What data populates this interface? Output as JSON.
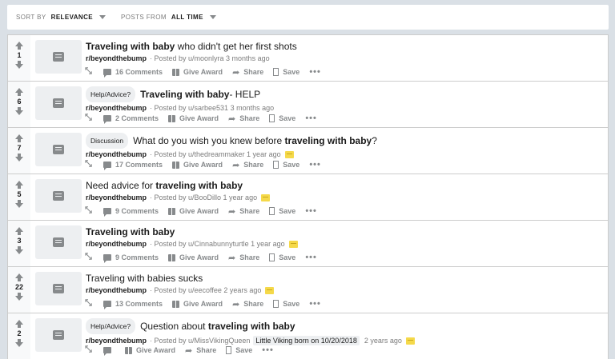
{
  "sort": {
    "label": "Sort by",
    "value": "RELEVANCE",
    "posts_label": "Posts from",
    "posts_value": "ALL TIME"
  },
  "posts": [
    {
      "score": "1",
      "flair": "",
      "title_parts": [
        {
          "text": "Traveling with baby",
          "bold": true
        },
        {
          "text": " who didn't get her first shots",
          "bold": false
        }
      ],
      "sub": "r/beyondthebump",
      "posted": "· Posted by u/moonlyra 3 months ago",
      "user_flair": "",
      "award": false,
      "comments": "16 Comments"
    },
    {
      "score": "6",
      "flair": "Help/Advice?",
      "title_parts": [
        {
          "text": "Traveling with baby",
          "bold": true
        },
        {
          "text": "- HELP",
          "bold": false
        }
      ],
      "sub": "r/beyondthebump",
      "posted": "· Posted by u/sarbee531 3 months ago",
      "user_flair": "",
      "award": false,
      "comments": "2 Comments"
    },
    {
      "score": "7",
      "flair": "Discussion",
      "title_parts": [
        {
          "text": "What do you wish you knew before ",
          "bold": false
        },
        {
          "text": "traveling with baby",
          "bold": true
        },
        {
          "text": "?",
          "bold": false
        }
      ],
      "sub": "r/beyondthebump",
      "posted": "· Posted by u/thedreammaker 1 year ago",
      "user_flair": "",
      "award": true,
      "comments": "17 Comments"
    },
    {
      "score": "5",
      "flair": "",
      "title_parts": [
        {
          "text": "Need advice for ",
          "bold": false
        },
        {
          "text": "traveling with baby",
          "bold": true
        }
      ],
      "sub": "r/beyondthebump",
      "posted": "· Posted by u/BooDillo 1 year ago",
      "user_flair": "",
      "award": true,
      "comments": "9 Comments"
    },
    {
      "score": "3",
      "flair": "",
      "title_parts": [
        {
          "text": "Traveling with baby",
          "bold": true
        }
      ],
      "sub": "r/beyondthebump",
      "posted": "· Posted by u/Cinnabunnyturtle 1 year ago",
      "user_flair": "",
      "award": true,
      "comments": "9 Comments"
    },
    {
      "score": "22",
      "flair": "",
      "title_parts": [
        {
          "text": "Traveling with babies sucks",
          "bold": false
        }
      ],
      "sub": "r/beyondthebump",
      "posted": "· Posted by u/eecoffee 2 years ago",
      "user_flair": "",
      "award": true,
      "comments": "13 Comments"
    },
    {
      "score": "2",
      "flair": "Help/Advice?",
      "title_parts": [
        {
          "text": "Question about ",
          "bold": false
        },
        {
          "text": "traveling with baby",
          "bold": true
        }
      ],
      "sub": "r/beyondthebump",
      "posted": "· Posted by u/MissVikingQueen",
      "user_flair": "Little Viking born on 10/20/2018",
      "posted_after": "2 years ago",
      "award": true,
      "comments": ""
    }
  ],
  "actions": {
    "award": "Give Award",
    "share": "Share",
    "save": "Save",
    "more": "•••"
  },
  "colors": {
    "background": "#dae0e6",
    "award_coin": "#f5d94a",
    "meta_gray": "#7c7c7c"
  },
  "icons": [
    "upvote-icon",
    "downvote-icon",
    "text-post-icon",
    "expand-icon",
    "comment-icon",
    "gift-icon",
    "share-icon",
    "bookmark-icon",
    "more-icon",
    "award-icon"
  ]
}
